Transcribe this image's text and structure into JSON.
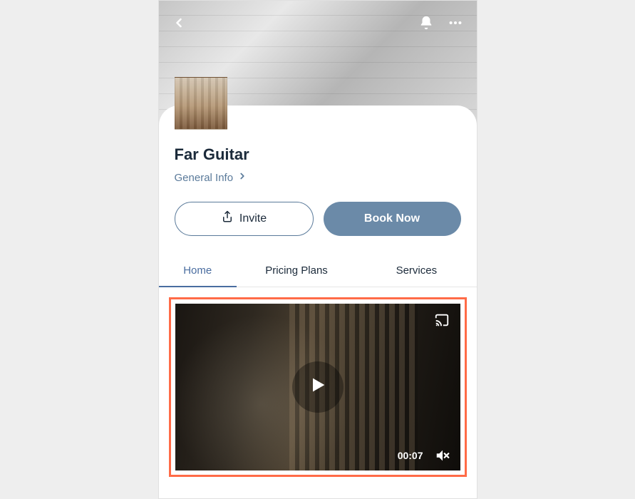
{
  "page": {
    "title": "Far Guitar",
    "subtitle": "General Info"
  },
  "buttons": {
    "invite": "Invite",
    "book": "Book Now"
  },
  "tabs": {
    "home": "Home",
    "pricing": "Pricing Plans",
    "services": "Services"
  },
  "video": {
    "timestamp": "00:07"
  },
  "icons": {
    "back": "back-icon",
    "bell": "bell-icon",
    "more": "more-icon",
    "share": "share-icon",
    "chevron": "chevron-right-icon",
    "play": "play-icon",
    "cast": "cast-icon",
    "mute": "mute-icon"
  },
  "colors": {
    "accent": "#4a6da0",
    "primaryButton": "#6b8aa8",
    "highlightBorder": "#ff6b47"
  }
}
